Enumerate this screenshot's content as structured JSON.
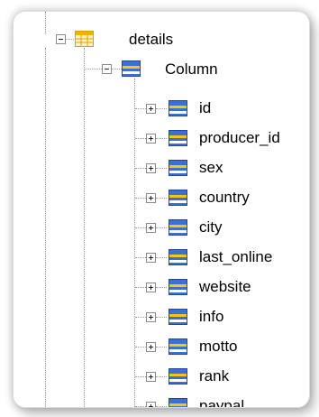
{
  "tree": {
    "root": {
      "label": "details",
      "icon": "table-icon",
      "expanded": true
    },
    "column_node": {
      "label": "Column",
      "icon": "column-group-icon",
      "expanded": true
    },
    "columns": [
      {
        "label": "id",
        "icon": "column-icon",
        "expanded": false
      },
      {
        "label": "producer_id",
        "icon": "column-icon",
        "expanded": false
      },
      {
        "label": "sex",
        "icon": "column-icon",
        "expanded": false
      },
      {
        "label": "country",
        "icon": "column-icon",
        "expanded": false
      },
      {
        "label": "city",
        "icon": "column-icon",
        "expanded": false
      },
      {
        "label": "last_online",
        "icon": "column-icon",
        "expanded": false
      },
      {
        "label": "website",
        "icon": "column-icon",
        "expanded": false
      },
      {
        "label": "info",
        "icon": "column-icon",
        "expanded": false
      },
      {
        "label": "motto",
        "icon": "column-icon",
        "expanded": false
      },
      {
        "label": "rank",
        "icon": "column-icon",
        "expanded": false
      },
      {
        "label": "paypal",
        "icon": "column-icon",
        "expanded": false
      }
    ]
  },
  "colors": {
    "icon_blue": "#3b6fd4",
    "icon_yellow": "#f5c518",
    "table_icon_border": "#e0a000"
  }
}
